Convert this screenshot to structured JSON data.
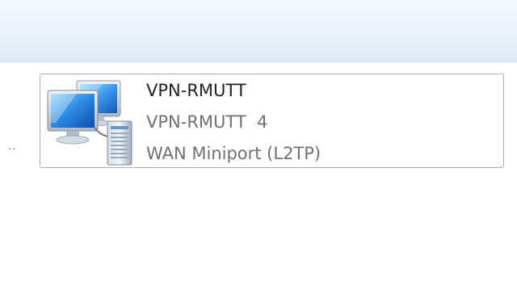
{
  "header": {
    "breadcrumb_overflow": ".."
  },
  "connection": {
    "name": "VPN-RMUTT",
    "status": "VPN-RMUTT  4",
    "device": "WAN Miniport (L2TP)",
    "icon": "network-connection-icon",
    "selected_border_color": "#9fb0c4"
  }
}
